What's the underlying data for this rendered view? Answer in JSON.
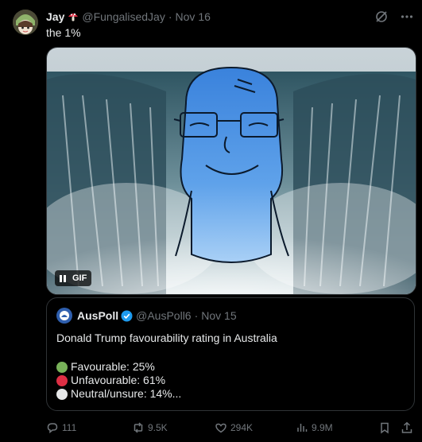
{
  "tweet": {
    "author_name": "Jay",
    "handle": "@FungalisedJay",
    "separator": "·",
    "date": "Nov 16",
    "text": "the 1%"
  },
  "media": {
    "badge": "GIF"
  },
  "quote": {
    "author_name": "AusPoll",
    "handle": "@AusPoll6",
    "separator": "·",
    "date": "Nov 15",
    "title": "Donald Trump favourability rating in Australia",
    "lines": [
      {
        "text": "Favourable: 25%",
        "color": "#78b159"
      },
      {
        "text": "Unfavourable: 61%",
        "color": "#dd2e44"
      },
      {
        "text": "Neutral/unsure: 14%...",
        "color": "#e6e7e8"
      }
    ]
  },
  "actions": {
    "replies": "111",
    "reposts": "9.5K",
    "likes": "294K",
    "views": "9.9M"
  },
  "colors": {
    "background": "#000000",
    "text": "#e7e9ea",
    "muted": "#71767b",
    "border": "#2f3336",
    "verified": "#1d9bf0"
  }
}
